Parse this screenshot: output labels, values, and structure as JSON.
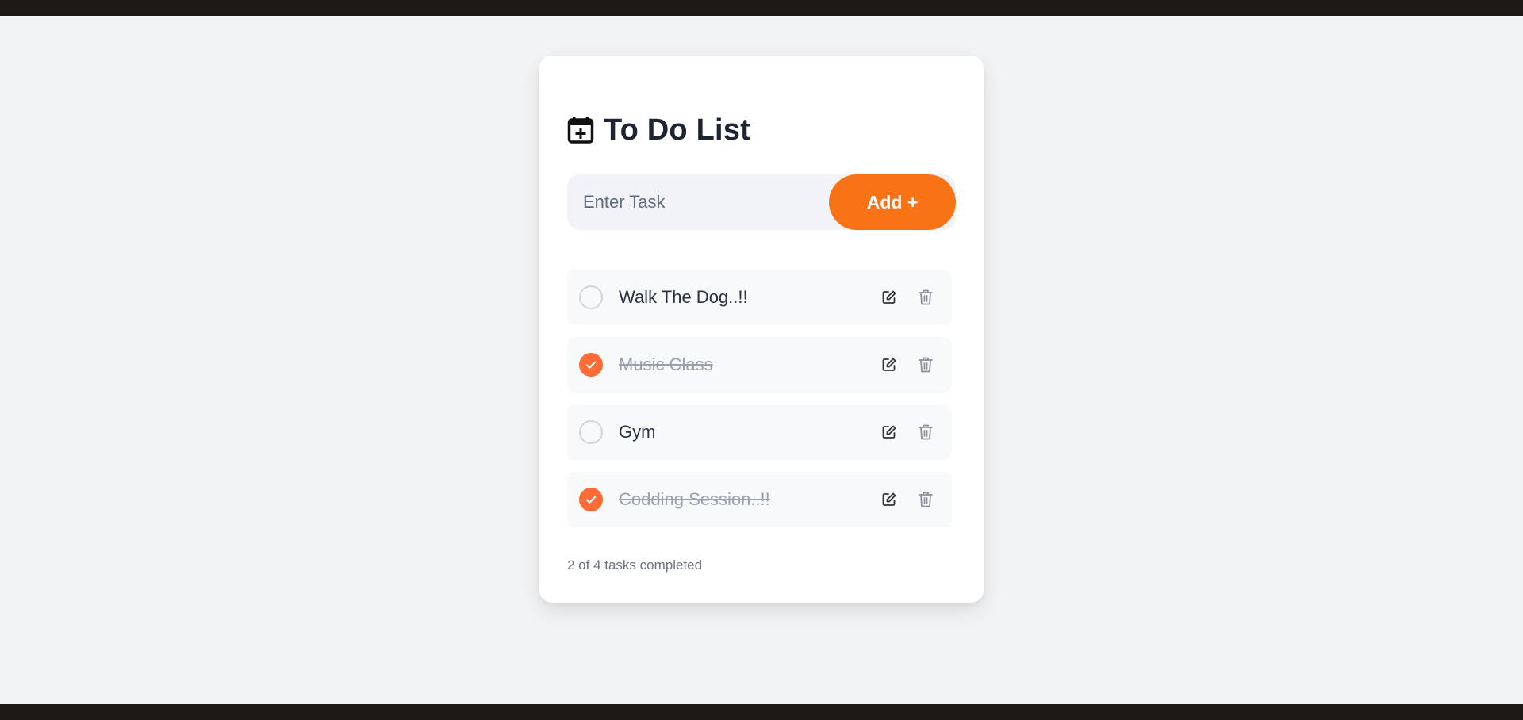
{
  "header": {
    "title": "To Do List",
    "icon": "calendar-plus-icon"
  },
  "input": {
    "placeholder": "Enter Task",
    "value": ""
  },
  "add_button": {
    "label": "Add +",
    "color": "#f97316"
  },
  "tasks": [
    {
      "text": "Walk The Dog..!!",
      "completed": false
    },
    {
      "text": "Music Class",
      "completed": true
    },
    {
      "text": "Gym",
      "completed": false
    },
    {
      "text": "Codding Session..!!",
      "completed": true
    }
  ],
  "icons": {
    "edit": "edit-icon",
    "delete": "trash-icon",
    "check": "check-icon"
  },
  "footer": {
    "status": "2 of 4 tasks completed"
  },
  "colors": {
    "accent": "#ff6b35",
    "text": "#1e2532",
    "muted": "#6b7280"
  }
}
